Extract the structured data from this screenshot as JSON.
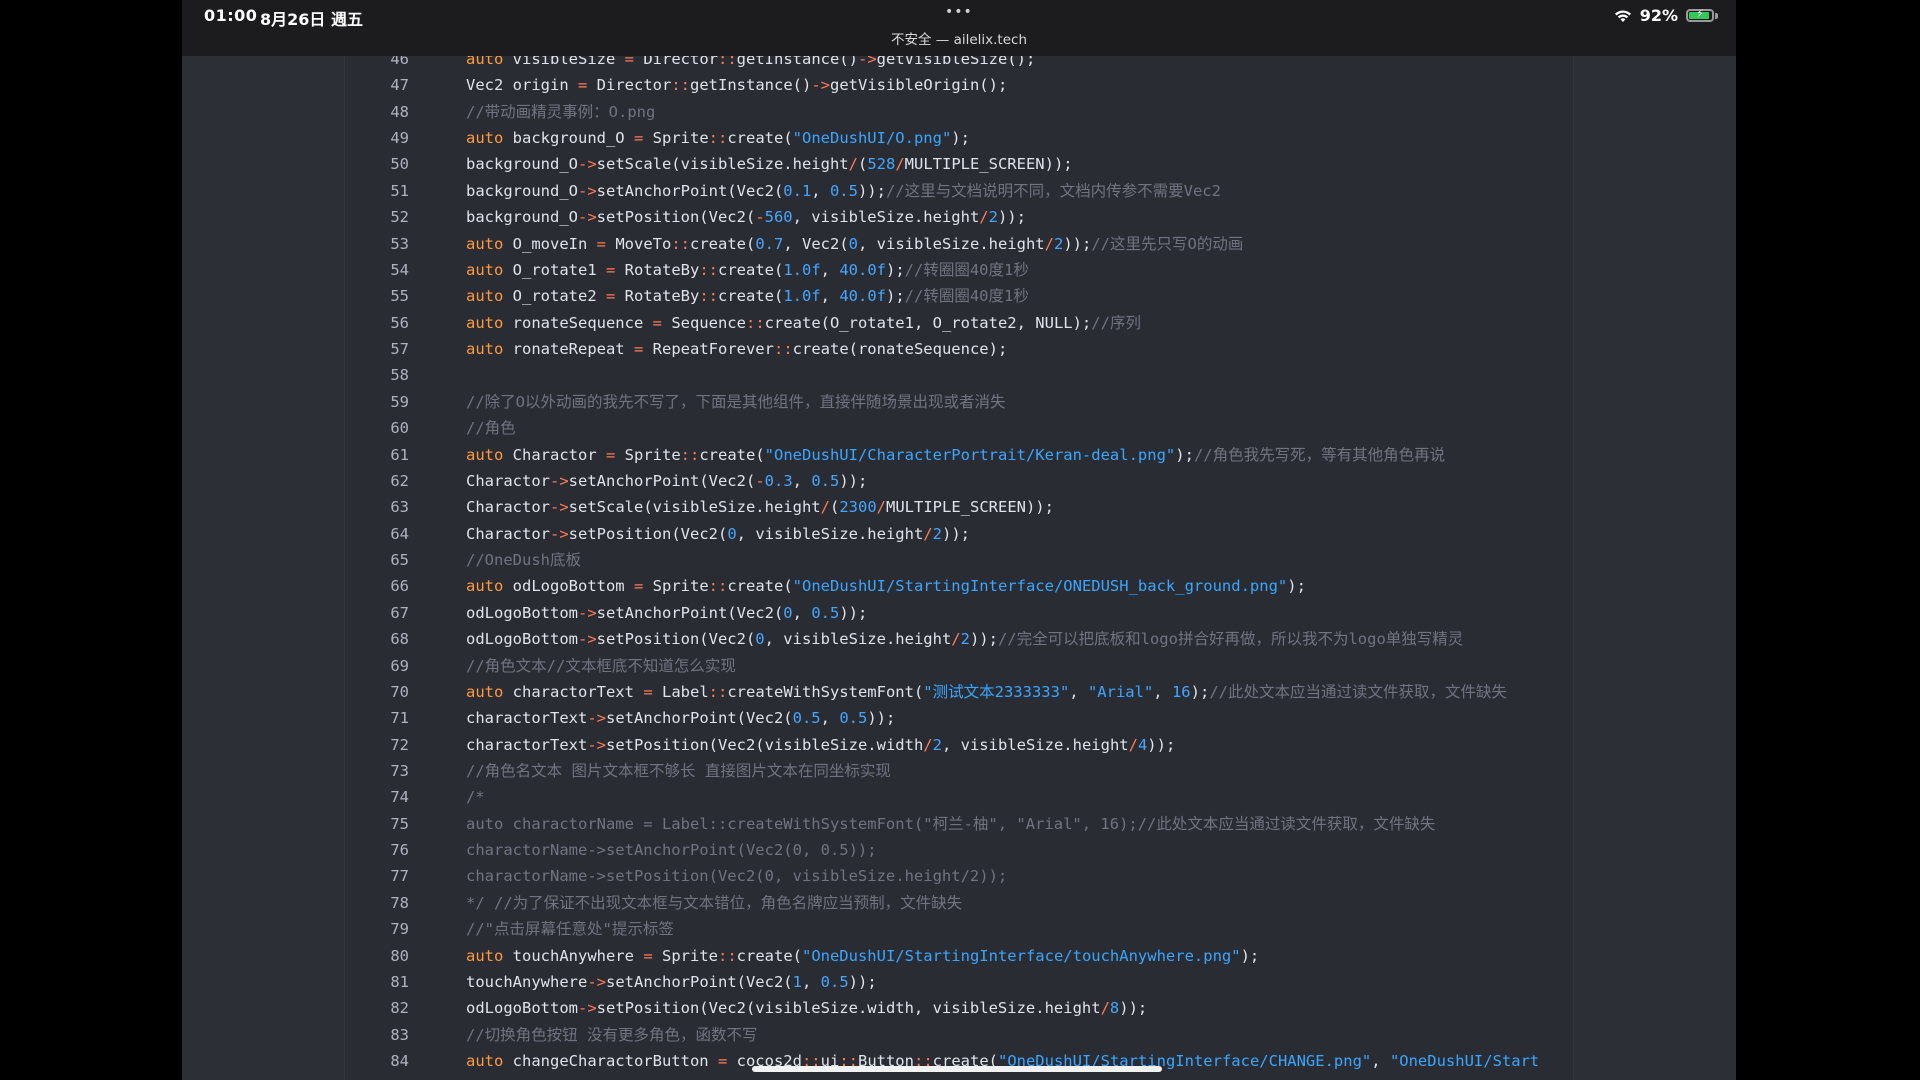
{
  "statusbar": {
    "time": "01:00",
    "date": "8月26日 週五",
    "dots": "•••",
    "url": "不安全 — ailelix.tech",
    "battery": "92%",
    "battery_level": 0.92,
    "icons": [
      "wifi-icon",
      "battery-icon"
    ],
    "battery_color": "#34c759"
  },
  "colors": {
    "background": "#292c33",
    "keyword": "#ff9a3c",
    "operator": "#ff7a57",
    "number": "#45a6ff",
    "string": "#3aa6ff",
    "comment": "#6f7480",
    "text": "#dfe3ea"
  },
  "lines": [
    {
      "n": "46",
      "tokens": [
        [
          "kw",
          "auto"
        ],
        [
          "plain",
          " visibleSize "
        ],
        [
          "op",
          "="
        ],
        [
          "plain",
          " Director"
        ],
        [
          "op",
          "::"
        ],
        [
          "plain",
          "getInstance()"
        ],
        [
          "op",
          "->"
        ],
        [
          "plain",
          "getVisibleSize();"
        ]
      ]
    },
    {
      "n": "47",
      "tokens": [
        [
          "plain",
          "Vec2 origin "
        ],
        [
          "op",
          "="
        ],
        [
          "plain",
          " Director"
        ],
        [
          "op",
          "::"
        ],
        [
          "plain",
          "getInstance()"
        ],
        [
          "op",
          "->"
        ],
        [
          "plain",
          "getVisibleOrigin();"
        ]
      ]
    },
    {
      "n": "48",
      "tokens": [
        [
          "com",
          "//带动画精灵事例：O.png"
        ]
      ]
    },
    {
      "n": "49",
      "tokens": [
        [
          "kw",
          "auto"
        ],
        [
          "plain",
          " background_O "
        ],
        [
          "op",
          "="
        ],
        [
          "plain",
          " Sprite"
        ],
        [
          "op",
          "::"
        ],
        [
          "plain",
          "create("
        ],
        [
          "str",
          "\"OneDushUI/O.png\""
        ],
        [
          "plain",
          ");"
        ]
      ]
    },
    {
      "n": "50",
      "tokens": [
        [
          "plain",
          "background_O"
        ],
        [
          "op",
          "->"
        ],
        [
          "plain",
          "setScale(visibleSize.height"
        ],
        [
          "op",
          "/"
        ],
        [
          "plain",
          "("
        ],
        [
          "num",
          "528"
        ],
        [
          "op",
          "/"
        ],
        [
          "plain",
          "MULTIPLE_SCREEN));"
        ]
      ]
    },
    {
      "n": "51",
      "tokens": [
        [
          "plain",
          "background_O"
        ],
        [
          "op",
          "->"
        ],
        [
          "plain",
          "setAnchorPoint(Vec2("
        ],
        [
          "num",
          "0.1"
        ],
        [
          "plain",
          ", "
        ],
        [
          "num",
          "0.5"
        ],
        [
          "plain",
          "));"
        ],
        [
          "com",
          "//这里与文档说明不同，文档内传参不需要Vec2"
        ]
      ]
    },
    {
      "n": "52",
      "tokens": [
        [
          "plain",
          "background_O"
        ],
        [
          "op",
          "->"
        ],
        [
          "plain",
          "setPosition(Vec2("
        ],
        [
          "op",
          "-"
        ],
        [
          "num",
          "560"
        ],
        [
          "plain",
          ", visibleSize.height"
        ],
        [
          "op",
          "/"
        ],
        [
          "num",
          "2"
        ],
        [
          "plain",
          "));"
        ]
      ]
    },
    {
      "n": "53",
      "tokens": [
        [
          "kw",
          "auto"
        ],
        [
          "plain",
          " O_moveIn "
        ],
        [
          "op",
          "="
        ],
        [
          "plain",
          " MoveTo"
        ],
        [
          "op",
          "::"
        ],
        [
          "plain",
          "create("
        ],
        [
          "num",
          "0.7"
        ],
        [
          "plain",
          ", Vec2("
        ],
        [
          "num",
          "0"
        ],
        [
          "plain",
          ", visibleSize.height"
        ],
        [
          "op",
          "/"
        ],
        [
          "num",
          "2"
        ],
        [
          "plain",
          "));"
        ],
        [
          "com",
          "//这里先只写O的动画"
        ]
      ]
    },
    {
      "n": "54",
      "tokens": [
        [
          "kw",
          "auto"
        ],
        [
          "plain",
          " O_rotate1 "
        ],
        [
          "op",
          "="
        ],
        [
          "plain",
          " RotateBy"
        ],
        [
          "op",
          "::"
        ],
        [
          "plain",
          "create("
        ],
        [
          "num",
          "1.0f"
        ],
        [
          "plain",
          ", "
        ],
        [
          "num",
          "40.0f"
        ],
        [
          "plain",
          ");"
        ],
        [
          "com",
          "//转圈圈40度1秒"
        ]
      ]
    },
    {
      "n": "55",
      "tokens": [
        [
          "kw",
          "auto"
        ],
        [
          "plain",
          " O_rotate2 "
        ],
        [
          "op",
          "="
        ],
        [
          "plain",
          " RotateBy"
        ],
        [
          "op",
          "::"
        ],
        [
          "plain",
          "create("
        ],
        [
          "num",
          "1.0f"
        ],
        [
          "plain",
          ", "
        ],
        [
          "num",
          "40.0f"
        ],
        [
          "plain",
          ");"
        ],
        [
          "com",
          "//转圈圈40度1秒"
        ]
      ]
    },
    {
      "n": "56",
      "tokens": [
        [
          "kw",
          "auto"
        ],
        [
          "plain",
          " ronateSequence "
        ],
        [
          "op",
          "="
        ],
        [
          "plain",
          " Sequence"
        ],
        [
          "op",
          "::"
        ],
        [
          "plain",
          "create(O_rotate1, O_rotate2, NULL);"
        ],
        [
          "com",
          "//序列"
        ]
      ]
    },
    {
      "n": "57",
      "tokens": [
        [
          "kw",
          "auto"
        ],
        [
          "plain",
          " ronateRepeat "
        ],
        [
          "op",
          "="
        ],
        [
          "plain",
          " RepeatForever"
        ],
        [
          "op",
          "::"
        ],
        [
          "plain",
          "create(ronateSequence);"
        ]
      ]
    },
    {
      "n": "58",
      "tokens": []
    },
    {
      "n": "59",
      "tokens": [
        [
          "com",
          "//除了O以外动画的我先不写了，下面是其他组件，直接伴随场景出现或者消失"
        ]
      ]
    },
    {
      "n": "60",
      "tokens": [
        [
          "com",
          "//角色"
        ]
      ]
    },
    {
      "n": "61",
      "tokens": [
        [
          "kw",
          "auto"
        ],
        [
          "plain",
          " Charactor "
        ],
        [
          "op",
          "="
        ],
        [
          "plain",
          " Sprite"
        ],
        [
          "op",
          "::"
        ],
        [
          "plain",
          "create("
        ],
        [
          "str",
          "\"OneDushUI/CharacterPortrait/Keran-deal.png\""
        ],
        [
          "plain",
          ");"
        ],
        [
          "com",
          "//角色我先写死，等有其他角色再说"
        ]
      ]
    },
    {
      "n": "62",
      "tokens": [
        [
          "plain",
          "Charactor"
        ],
        [
          "op",
          "->"
        ],
        [
          "plain",
          "setAnchorPoint(Vec2("
        ],
        [
          "op",
          "-"
        ],
        [
          "num",
          "0.3"
        ],
        [
          "plain",
          ", "
        ],
        [
          "num",
          "0.5"
        ],
        [
          "plain",
          "));"
        ]
      ]
    },
    {
      "n": "63",
      "tokens": [
        [
          "plain",
          "Charactor"
        ],
        [
          "op",
          "->"
        ],
        [
          "plain",
          "setScale(visibleSize.height"
        ],
        [
          "op",
          "/"
        ],
        [
          "plain",
          "("
        ],
        [
          "num",
          "2300"
        ],
        [
          "op",
          "/"
        ],
        [
          "plain",
          "MULTIPLE_SCREEN));"
        ]
      ]
    },
    {
      "n": "64",
      "tokens": [
        [
          "plain",
          "Charactor"
        ],
        [
          "op",
          "->"
        ],
        [
          "plain",
          "setPosition(Vec2("
        ],
        [
          "num",
          "0"
        ],
        [
          "plain",
          ", visibleSize.height"
        ],
        [
          "op",
          "/"
        ],
        [
          "num",
          "2"
        ],
        [
          "plain",
          "));"
        ]
      ]
    },
    {
      "n": "65",
      "tokens": [
        [
          "com",
          "//OneDush底板"
        ]
      ]
    },
    {
      "n": "66",
      "tokens": [
        [
          "kw",
          "auto"
        ],
        [
          "plain",
          " odLogoBottom "
        ],
        [
          "op",
          "="
        ],
        [
          "plain",
          " Sprite"
        ],
        [
          "op",
          "::"
        ],
        [
          "plain",
          "create("
        ],
        [
          "str",
          "\"OneDushUI/StartingInterface/ONEDUSH_back_ground.png\""
        ],
        [
          "plain",
          ");"
        ]
      ]
    },
    {
      "n": "67",
      "tokens": [
        [
          "plain",
          "odLogoBottom"
        ],
        [
          "op",
          "->"
        ],
        [
          "plain",
          "setAnchorPoint(Vec2("
        ],
        [
          "num",
          "0"
        ],
        [
          "plain",
          ", "
        ],
        [
          "num",
          "0.5"
        ],
        [
          "plain",
          "));"
        ]
      ]
    },
    {
      "n": "68",
      "tokens": [
        [
          "plain",
          "odLogoBottom"
        ],
        [
          "op",
          "->"
        ],
        [
          "plain",
          "setPosition(Vec2("
        ],
        [
          "num",
          "0"
        ],
        [
          "plain",
          ", visibleSize.height"
        ],
        [
          "op",
          "/"
        ],
        [
          "num",
          "2"
        ],
        [
          "plain",
          "));"
        ],
        [
          "com",
          "//完全可以把底板和logo拼合好再做，所以我不为logo单独写精灵"
        ]
      ]
    },
    {
      "n": "69",
      "tokens": [
        [
          "com",
          "//角色文本//文本框底不知道怎么实现"
        ]
      ]
    },
    {
      "n": "70",
      "tokens": [
        [
          "kw",
          "auto"
        ],
        [
          "plain",
          " charactorText "
        ],
        [
          "op",
          "="
        ],
        [
          "plain",
          " Label"
        ],
        [
          "op",
          "::"
        ],
        [
          "plain",
          "createWithSystemFont("
        ],
        [
          "str",
          "\"测试文本2333333\""
        ],
        [
          "plain",
          ", "
        ],
        [
          "str",
          "\"Arial\""
        ],
        [
          "plain",
          ", "
        ],
        [
          "num",
          "16"
        ],
        [
          "plain",
          ");"
        ],
        [
          "com",
          "//此处文本应当通过读文件获取，文件缺失"
        ]
      ]
    },
    {
      "n": "71",
      "tokens": [
        [
          "plain",
          "charactorText"
        ],
        [
          "op",
          "->"
        ],
        [
          "plain",
          "setAnchorPoint(Vec2("
        ],
        [
          "num",
          "0.5"
        ],
        [
          "plain",
          ", "
        ],
        [
          "num",
          "0.5"
        ],
        [
          "plain",
          "));"
        ]
      ]
    },
    {
      "n": "72",
      "tokens": [
        [
          "plain",
          "charactorText"
        ],
        [
          "op",
          "->"
        ],
        [
          "plain",
          "setPosition(Vec2(visibleSize.width"
        ],
        [
          "op",
          "/"
        ],
        [
          "num",
          "2"
        ],
        [
          "plain",
          ", visibleSize.height"
        ],
        [
          "op",
          "/"
        ],
        [
          "num",
          "4"
        ],
        [
          "plain",
          "));"
        ]
      ]
    },
    {
      "n": "73",
      "tokens": [
        [
          "com",
          "//角色名文本 图片文本框不够长 直接图片文本在同坐标实现"
        ]
      ]
    },
    {
      "n": "74",
      "tokens": [
        [
          "com",
          "/*"
        ]
      ]
    },
    {
      "n": "75",
      "tokens": [
        [
          "dis",
          "auto charactorName = Label::createWithSystemFont(\"柯兰-柚\", \"Arial\", 16);//此处文本应当通过读文件获取，文件缺失"
        ]
      ]
    },
    {
      "n": "76",
      "tokens": [
        [
          "dis",
          "charactorName->setAnchorPoint(Vec2(0, 0.5));"
        ]
      ]
    },
    {
      "n": "77",
      "tokens": [
        [
          "dis",
          "charactorName->setPosition(Vec2(0, visibleSize.height/2));"
        ]
      ]
    },
    {
      "n": "78",
      "tokens": [
        [
          "com",
          "*/ //为了保证不出现文本框与文本错位，角色名牌应当预制，文件缺失"
        ]
      ]
    },
    {
      "n": "79",
      "tokens": [
        [
          "com",
          "//\"点击屏幕任意处\"提示标签"
        ]
      ]
    },
    {
      "n": "80",
      "tokens": [
        [
          "kw",
          "auto"
        ],
        [
          "plain",
          " touchAnywhere "
        ],
        [
          "op",
          "="
        ],
        [
          "plain",
          " Sprite"
        ],
        [
          "op",
          "::"
        ],
        [
          "plain",
          "create("
        ],
        [
          "str",
          "\"OneDushUI/StartingInterface/touchAnywhere.png\""
        ],
        [
          "plain",
          ");"
        ]
      ]
    },
    {
      "n": "81",
      "tokens": [
        [
          "plain",
          "touchAnywhere"
        ],
        [
          "op",
          "->"
        ],
        [
          "plain",
          "setAnchorPoint(Vec2("
        ],
        [
          "num",
          "1"
        ],
        [
          "plain",
          ", "
        ],
        [
          "num",
          "0.5"
        ],
        [
          "plain",
          "));"
        ]
      ]
    },
    {
      "n": "82",
      "tokens": [
        [
          "plain",
          "odLogoBottom"
        ],
        [
          "op",
          "->"
        ],
        [
          "plain",
          "setPosition(Vec2(visibleSize.width, visibleSize.height"
        ],
        [
          "op",
          "/"
        ],
        [
          "num",
          "8"
        ],
        [
          "plain",
          "));"
        ]
      ]
    },
    {
      "n": "83",
      "tokens": [
        [
          "com",
          "//切换角色按钮 没有更多角色，函数不写"
        ]
      ]
    },
    {
      "n": "84",
      "tokens": [
        [
          "kw",
          "auto"
        ],
        [
          "plain",
          " changeCharactorButton "
        ],
        [
          "op",
          "="
        ],
        [
          "plain",
          " cocos2d"
        ],
        [
          "op",
          "::"
        ],
        [
          "plain",
          "ui"
        ],
        [
          "op",
          "::"
        ],
        [
          "plain",
          "Button"
        ],
        [
          "op",
          "::"
        ],
        [
          "plain",
          "create("
        ],
        [
          "str",
          "\"OneDushUI/StartingInterface/CHANGE.png\""
        ],
        [
          "plain",
          ", "
        ],
        [
          "str",
          "\"OneDushUI/Start"
        ]
      ]
    }
  ]
}
